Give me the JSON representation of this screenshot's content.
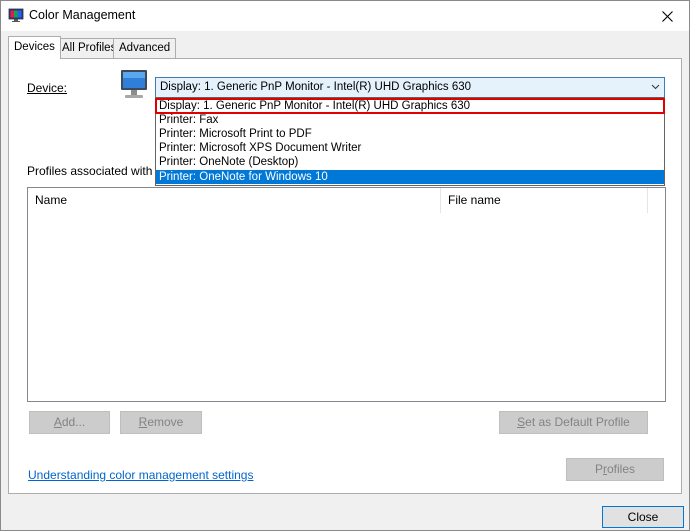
{
  "window": {
    "title": "Color Management",
    "app_icon": "color-management-icon",
    "close_icon": "close-icon"
  },
  "tabs": [
    {
      "label": "Devices",
      "active": true
    },
    {
      "label": "All Profiles",
      "active": false
    },
    {
      "label": "Advanced",
      "active": false
    }
  ],
  "device": {
    "label": "Device:",
    "selected_value": "Display: 1. Generic PnP Monitor - Intel(R) UHD Graphics 630",
    "options": [
      {
        "label": "Display: 1. Generic PnP Monitor - Intel(R) UHD Graphics 630",
        "highlighted": true
      },
      {
        "label": "Printer: Fax"
      },
      {
        "label": "Printer: Microsoft Print to PDF"
      },
      {
        "label": "Printer: Microsoft XPS Document Writer"
      },
      {
        "label": "Printer: OneNote (Desktop)"
      },
      {
        "label": "Printer: OneNote for Windows 10",
        "hover": true
      }
    ]
  },
  "profiles": {
    "label_visible": "Profiles associated with th",
    "columns": [
      "Name",
      "File name"
    ],
    "rows": []
  },
  "buttons": {
    "add": {
      "label_ul": "A",
      "label_rest": "dd..."
    },
    "remove": {
      "label_ul": "R",
      "label_rest": "emove"
    },
    "set_default": {
      "label_ul": "S",
      "label_rest": "et as Default Profile"
    },
    "profiles": {
      "label_pre": "P",
      "label_ul": "r",
      "label_rest": "ofiles"
    },
    "close": {
      "label": "Close"
    }
  },
  "link": {
    "text": "Understanding color management settings"
  },
  "colors": {
    "accent": "#0078d7",
    "highlight_border": "#e00000",
    "link": "#0066cc"
  }
}
